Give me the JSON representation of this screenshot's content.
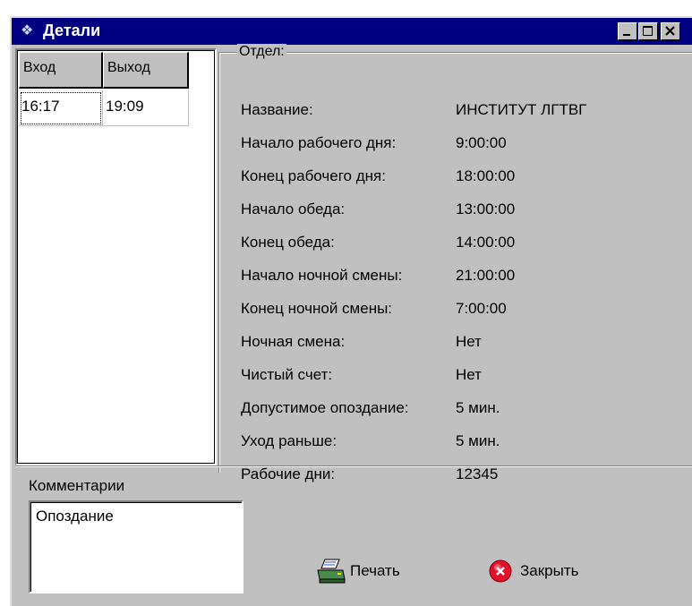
{
  "window": {
    "title": "Детали",
    "icon": "app-icon",
    "controls": [
      "minimize-icon",
      "maximize-icon",
      "close-icon"
    ]
  },
  "list": {
    "columns": [
      "Вход",
      "Выход"
    ],
    "rows": [
      [
        "16:17",
        "19:09"
      ]
    ]
  },
  "group": {
    "legend": "Отдел:",
    "fields": [
      {
        "label": "Название:",
        "value": "ИНСТИТУТ  ЛГТВГ"
      },
      {
        "label": "Начало рабочего дня:",
        "value": "9:00:00"
      },
      {
        "label": "Конец рабочего дня:",
        "value": "18:00:00"
      },
      {
        "label": "Начало обеда:",
        "value": "13:00:00"
      },
      {
        "label": "Конец обеда:",
        "value": "14:00:00"
      },
      {
        "label": "Начало ночной смены:",
        "value": "21:00:00"
      },
      {
        "label": "Конец ночной смены:",
        "value": "7:00:00"
      },
      {
        "label": "Ночная смена:",
        "value": "Нет"
      },
      {
        "label": "Чистый счет:",
        "value": "Нет"
      },
      {
        "label": "Допустимое опоздание:",
        "value": "5 мин."
      },
      {
        "label": "Уход раньше:",
        "value": "5 мин."
      },
      {
        "label": "Рабочие дни:",
        "value": "12345"
      }
    ]
  },
  "comments": {
    "label": "Комментарии",
    "value": "Опоздание"
  },
  "buttons": {
    "print": {
      "label": "Печать",
      "icon": "printer-icon"
    },
    "close": {
      "label": "Закрыть",
      "icon": "close-circle-icon"
    }
  },
  "colors": {
    "titlebar": "#000080",
    "face": "#c0c0c0",
    "close_icon": "#e0102a"
  }
}
